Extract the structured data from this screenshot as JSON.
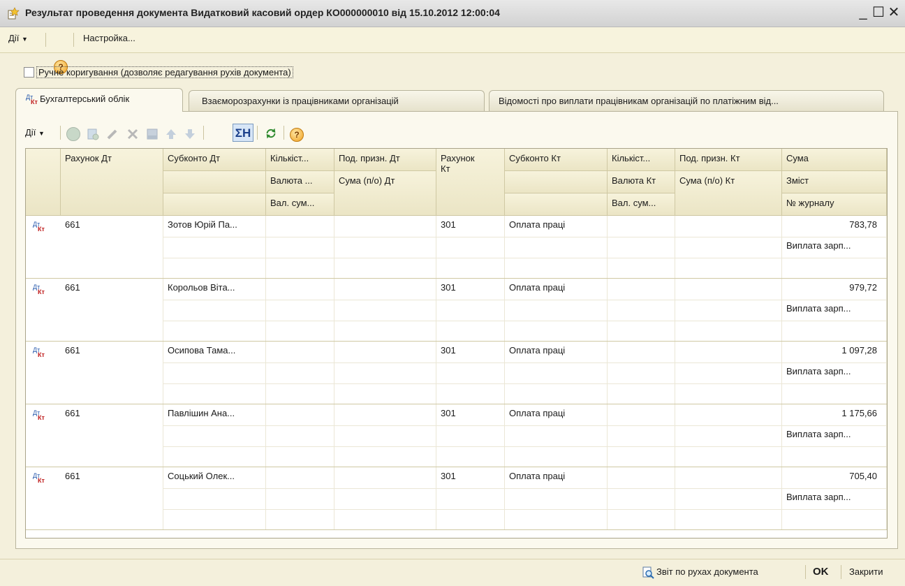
{
  "window": {
    "title": "Результат проведення документа Видатковий касовий ордер КО000000010 від 15.10.2012 12:00:04",
    "minimize": "_",
    "maximize": "☐",
    "close": "✕"
  },
  "menu": {
    "actions": "Дії",
    "help": "?",
    "settings": "Настройка..."
  },
  "manual_edit": {
    "label": "Ручне коригування (дозволяє редагування рухів документа)",
    "checked": false
  },
  "tabs": [
    {
      "label": "Бухгалтерський облік",
      "active": true,
      "icon_top": "Дт",
      "icon_bottom": "Кт"
    },
    {
      "label": "Взаєморозрахунки із працівниками організацій",
      "active": false
    },
    {
      "label": "Відомості про виплати працівникам організацій по платіжним від...",
      "active": false
    }
  ],
  "toolbar": {
    "actions": "Дії",
    "sigma": "ΣН",
    "icons": [
      "add-icon",
      "copy-icon",
      "edit-icon",
      "delete-icon",
      "csv-icon",
      "move-up-icon",
      "move-down-icon",
      "sum-icon",
      "refresh-icon",
      "help-icon"
    ]
  },
  "table": {
    "headers": {
      "c1": "Рахунок Дт",
      "c2": "Субконто Дт",
      "c3": [
        "Кількіст...",
        "Валюта ...",
        "Вал. сум..."
      ],
      "c4": [
        "Под. призн. Дт",
        "Сума (п/о) Дт"
      ],
      "c5": "Рахунок Кт",
      "c6": "Субконто Кт",
      "c7": [
        "Кількіст...",
        "Валюта Кт",
        "Вал. сум..."
      ],
      "c8": [
        "Под. призн. Кт",
        "Сума (п/о) Кт"
      ],
      "c9": [
        "Сума",
        "Зміст",
        "№ журналу"
      ]
    },
    "rows": [
      {
        "acc_dt": "661",
        "subconto_dt": "Зотов Юрій Па...",
        "acc_kt": "301",
        "subconto_kt": "Оплата праці",
        "sum": "783,78",
        "content": "Виплата зарп..."
      },
      {
        "acc_dt": "661",
        "subconto_dt": "Корольов Віта...",
        "acc_kt": "301",
        "subconto_kt": "Оплата праці",
        "sum": "979,72",
        "content": "Виплата зарп..."
      },
      {
        "acc_dt": "661",
        "subconto_dt": "Осипова Тама...",
        "acc_kt": "301",
        "subconto_kt": "Оплата праці",
        "sum": "1 097,28",
        "content": "Виплата зарп..."
      },
      {
        "acc_dt": "661",
        "subconto_dt": "Павлішин Ана...",
        "acc_kt": "301",
        "subconto_kt": "Оплата праці",
        "sum": "1 175,66",
        "content": "Виплата зарп..."
      },
      {
        "acc_dt": "661",
        "subconto_dt": "Соцький Олек...",
        "acc_kt": "301",
        "subconto_kt": "Оплата праці",
        "sum": "705,40",
        "content": "Виплата зарп..."
      }
    ],
    "row_icon": {
      "top": "Дт",
      "bottom": "Кт"
    }
  },
  "footer": {
    "report": "Звіт по рухах документа",
    "ok": "OK",
    "close": "Закрити"
  }
}
